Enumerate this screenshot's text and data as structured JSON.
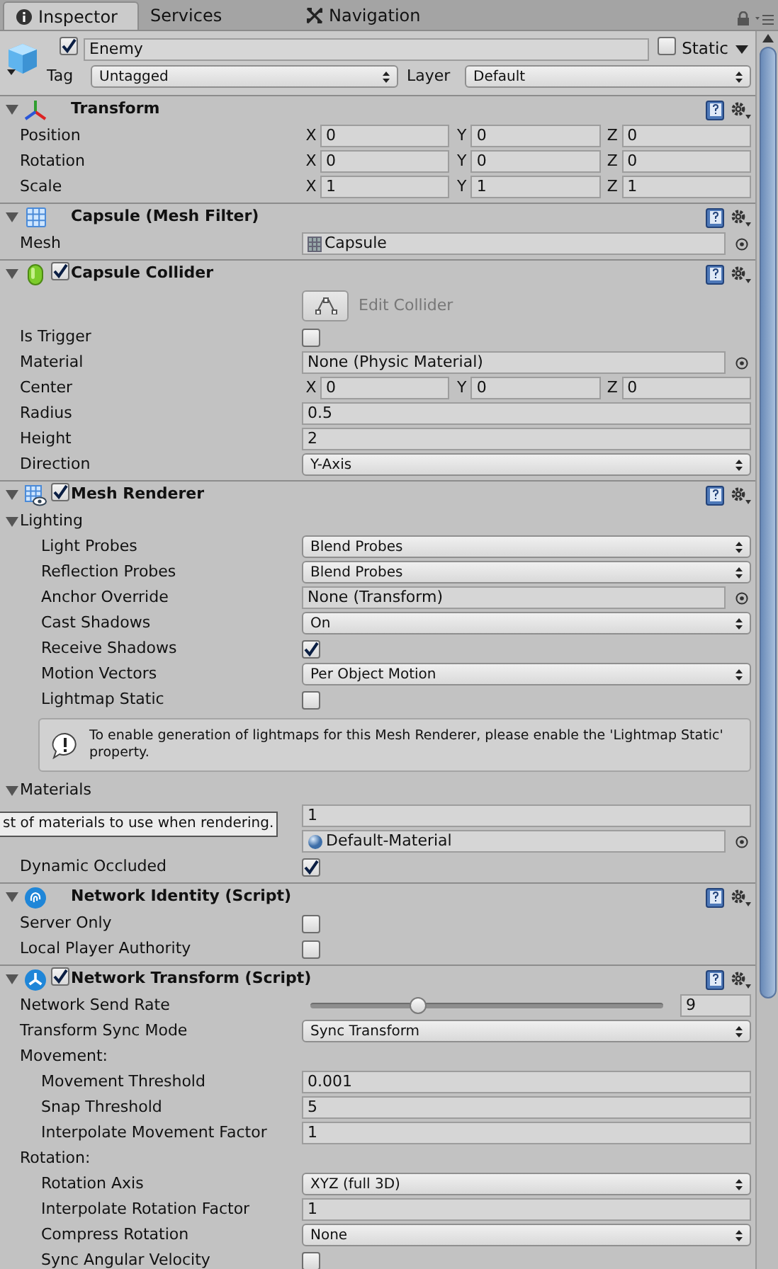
{
  "tabs": [
    {
      "label": "Inspector",
      "selected": true
    },
    {
      "label": "Services",
      "selected": false
    },
    {
      "label": "Navigation",
      "selected": false
    }
  ],
  "object": {
    "active": true,
    "name": "Enemy",
    "static": false,
    "static_label": "Static",
    "tag_label": "Tag",
    "tag": "Untagged",
    "layer_label": "Layer",
    "layer": "Default"
  },
  "components": [
    {
      "title": "Transform",
      "expanded": true,
      "rows": [
        {
          "kind": "vector3",
          "label": "Position",
          "axes": [
            {
              "axis": "X",
              "value": "0"
            },
            {
              "axis": "Y",
              "value": "0"
            },
            {
              "axis": "Z",
              "value": "0"
            }
          ]
        },
        {
          "kind": "vector3",
          "label": "Rotation",
          "axes": [
            {
              "axis": "X",
              "value": "0"
            },
            {
              "axis": "Y",
              "value": "0"
            },
            {
              "axis": "Z",
              "value": "0"
            }
          ]
        },
        {
          "kind": "vector3",
          "label": "Scale",
          "axes": [
            {
              "axis": "X",
              "value": "1"
            },
            {
              "axis": "Y",
              "value": "1"
            },
            {
              "axis": "Z",
              "value": "1"
            }
          ]
        }
      ]
    },
    {
      "title": "Capsule (Mesh Filter)",
      "expanded": true,
      "rows": [
        {
          "kind": "meshref",
          "label": "Mesh",
          "value": "Capsule"
        }
      ]
    },
    {
      "title": "Capsule Collider",
      "enabled": true,
      "expanded": true,
      "rows": [
        {
          "kind": "button",
          "text": "Edit Collider"
        },
        {
          "kind": "checkbox",
          "label": "Is Trigger",
          "checked": false
        },
        {
          "kind": "object",
          "label": "Material",
          "value": "None (Physic Material)"
        },
        {
          "kind": "vector3",
          "label": "Center",
          "axes": [
            {
              "axis": "X",
              "value": "0"
            },
            {
              "axis": "Y",
              "value": "0"
            },
            {
              "axis": "Z",
              "value": "0"
            }
          ]
        },
        {
          "kind": "text",
          "label": "Radius",
          "value": "0.5"
        },
        {
          "kind": "text",
          "label": "Height",
          "value": "2"
        },
        {
          "kind": "dropdown",
          "label": "Direction",
          "value": "Y-Axis"
        }
      ]
    },
    {
      "title": "Mesh Renderer",
      "enabled": true,
      "expanded": true,
      "rows": [
        {
          "kind": "foldout",
          "label": "Lighting",
          "expanded": true,
          "children": [
            {
              "kind": "dropdown",
              "label": "Light Probes",
              "value": "Blend Probes"
            },
            {
              "kind": "dropdown",
              "label": "Reflection Probes",
              "value": "Blend Probes"
            },
            {
              "kind": "object",
              "label": "Anchor Override",
              "value": "None (Transform)"
            },
            {
              "kind": "dropdown",
              "label": "Cast Shadows",
              "value": "On"
            },
            {
              "kind": "checkbox",
              "label": "Receive Shadows",
              "checked": true
            },
            {
              "kind": "dropdown",
              "label": "Motion Vectors",
              "value": "Per Object Motion"
            },
            {
              "kind": "checkbox",
              "label": "Lightmap Static",
              "checked": false
            },
            {
              "kind": "help",
              "text": "To enable generation of lightmaps for this Mesh Renderer, please enable the 'Lightmap Static' property."
            }
          ]
        },
        {
          "kind": "foldout",
          "label": "Materials",
          "expanded": true,
          "children": [
            {
              "kind": "text",
              "value": "1"
            },
            {
              "kind": "materialref",
              "value": "Default-Material"
            }
          ]
        },
        {
          "kind": "checkbox",
          "label": "Dynamic Occluded",
          "checked": true
        }
      ]
    },
    {
      "title": "Network Identity (Script)",
      "expanded": true,
      "rows": [
        {
          "kind": "checkbox",
          "label": "Server Only",
          "checked": false
        },
        {
          "kind": "checkbox",
          "label": "Local Player Authority",
          "checked": false
        }
      ]
    },
    {
      "title": "Network Transform (Script)",
      "enabled": true,
      "expanded": true,
      "rows": [
        {
          "kind": "slider",
          "label": "Network Send Rate",
          "level": 0.305,
          "value": "9"
        },
        {
          "kind": "dropdown",
          "label": "Transform Sync Mode",
          "value": "Sync Transform"
        },
        {
          "kind": "group",
          "label": "Movement:",
          "children": [
            {
              "kind": "text",
              "label": "Movement Threshold",
              "value": "0.001"
            },
            {
              "kind": "text",
              "label": "Snap Threshold",
              "value": "5"
            },
            {
              "kind": "text",
              "label": "Interpolate Movement Factor",
              "value": "1"
            }
          ]
        },
        {
          "kind": "group",
          "label": "Rotation:",
          "children": [
            {
              "kind": "dropdown",
              "label": "Rotation Axis",
              "value": "XYZ (full 3D)"
            },
            {
              "kind": "text",
              "label": "Interpolate Rotation Factor",
              "value": "1"
            },
            {
              "kind": "dropdown",
              "label": "Compress Rotation",
              "value": "None"
            },
            {
              "kind": "checkbox",
              "label": "Sync Angular Velocity",
              "checked": false
            }
          ]
        }
      ]
    }
  ],
  "tooltip": "st of materials to use when rendering."
}
